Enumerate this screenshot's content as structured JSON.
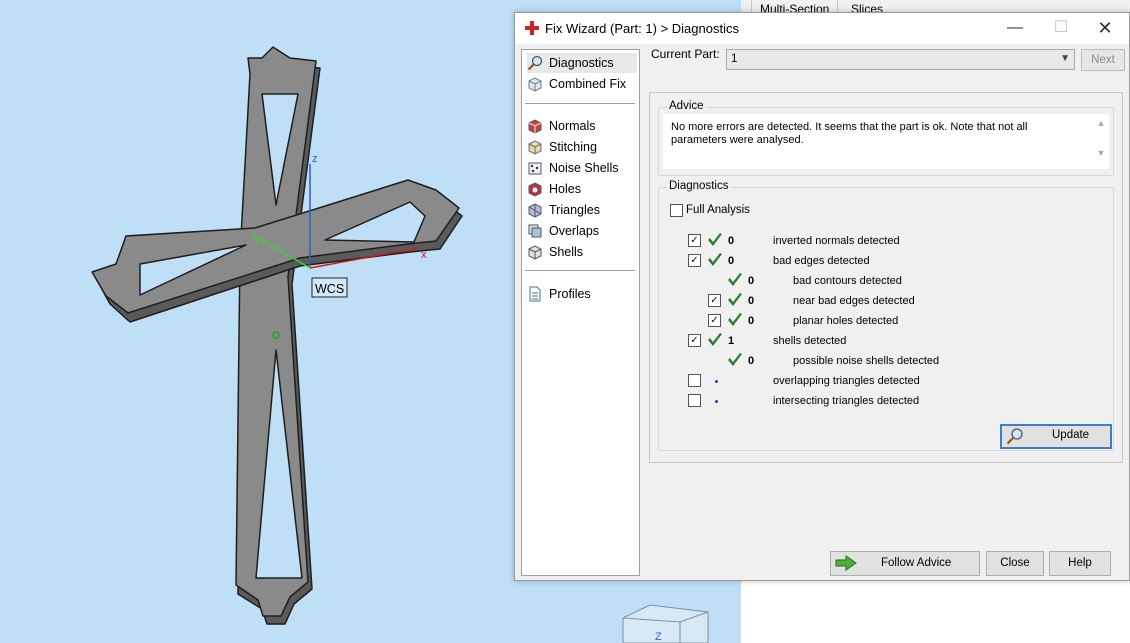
{
  "viewport": {
    "axis_z_label": "z",
    "axis_x_label": "x",
    "axis_y_label": "y",
    "wcs_label": "WCS",
    "nav_cube_label": "Z",
    "colors": {
      "background": "#bfdff7",
      "part_fill": "#8a8a8a",
      "part_edge": "#2a2a2a"
    }
  },
  "background_tabs": [
    "Multi-Section",
    "Slices"
  ],
  "dialog": {
    "title": "Fix Wizard (Part: 1) > Diagnostics",
    "title_icon": "red-cross-icon",
    "window_buttons": {
      "minimize": "—",
      "maximize": "☐",
      "close": "✕"
    },
    "nav": {
      "top_items": [
        {
          "label": "Diagnostics",
          "icon": "magnifier-icon",
          "selected": true
        },
        {
          "label": "Combined Fix",
          "icon": "cube-icon"
        }
      ],
      "fix_items": [
        {
          "label": "Normals",
          "icon": "normals-cube-icon"
        },
        {
          "label": "Stitching",
          "icon": "stitching-cube-icon"
        },
        {
          "label": "Noise Shells",
          "icon": "noise-shells-icon"
        },
        {
          "label": "Holes",
          "icon": "holes-icon"
        },
        {
          "label": "Triangles",
          "icon": "triangles-icon"
        },
        {
          "label": "Overlaps",
          "icon": "overlaps-icon"
        },
        {
          "label": "Shells",
          "icon": "shells-icon"
        }
      ],
      "bottom_items": [
        {
          "label": "Profiles",
          "icon": "document-icon"
        }
      ]
    },
    "current_part_label": "Current Part:",
    "current_part_value": "1",
    "next_label": "Next",
    "advice": {
      "title": "Advice",
      "text": "No more errors are detected. It seems that the part is ok. Note that not all parameters were analysed."
    },
    "diagnostics": {
      "title": "Diagnostics",
      "full_analysis_label": "Full Analysis",
      "full_analysis_checked": false,
      "rows": [
        {
          "checkbox": true,
          "checked": true,
          "status": "ok",
          "count": "0",
          "label": "inverted normals detected",
          "indent": 0
        },
        {
          "checkbox": true,
          "checked": true,
          "status": "ok",
          "count": "0",
          "label": "bad edges detected",
          "indent": 0
        },
        {
          "checkbox": false,
          "checked": false,
          "status": "ok",
          "count": "0",
          "label": "bad contours detected",
          "indent": 1
        },
        {
          "checkbox": true,
          "checked": true,
          "status": "ok",
          "count": "0",
          "label": "near bad edges detected",
          "indent": 1
        },
        {
          "checkbox": true,
          "checked": true,
          "status": "ok",
          "count": "0",
          "label": "planar holes detected",
          "indent": 1
        },
        {
          "checkbox": true,
          "checked": true,
          "status": "ok",
          "count": "1",
          "label": "shells detected",
          "indent": 0
        },
        {
          "checkbox": false,
          "checked": false,
          "status": "ok",
          "count": "0",
          "label": "possible noise shells detected",
          "indent": 1
        },
        {
          "checkbox": true,
          "checked": false,
          "status": "pending",
          "count": "",
          "label": "overlapping triangles detected",
          "indent": 0
        },
        {
          "checkbox": true,
          "checked": false,
          "status": "pending",
          "count": "",
          "label": "intersecting triangles detected",
          "indent": 0
        }
      ],
      "update_label": "Update"
    },
    "buttons": {
      "follow_advice": "Follow Advice",
      "close": "Close",
      "help": "Help"
    },
    "colors": {
      "check_green": "#2e7d32",
      "update_border": "#3c7fc8",
      "title_icon_red": "#d32020"
    }
  }
}
